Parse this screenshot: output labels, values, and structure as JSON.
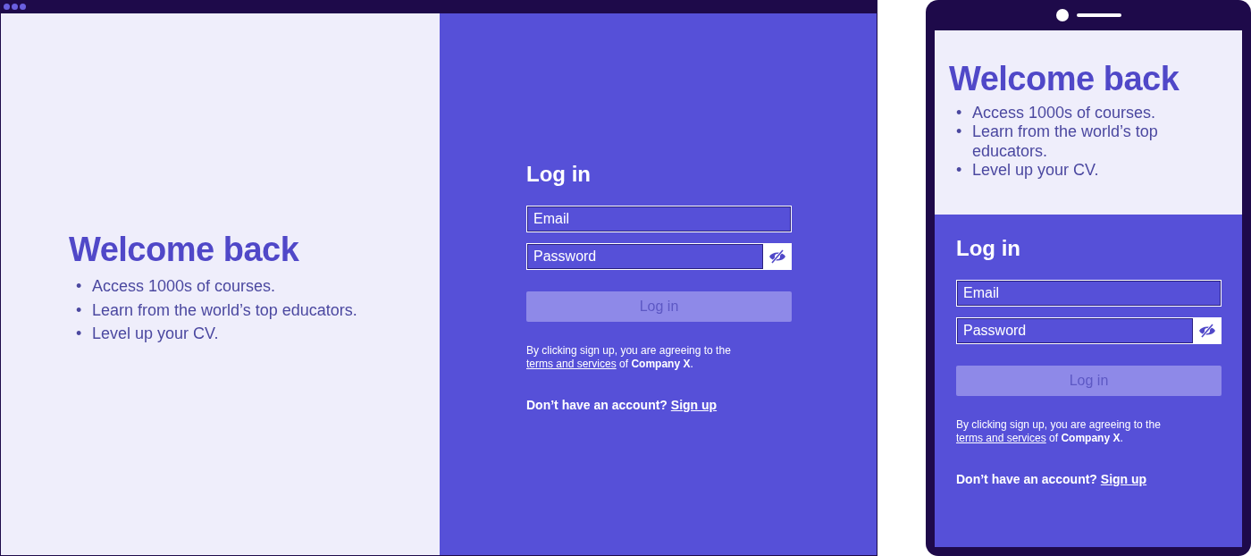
{
  "desktop": {
    "welcome": {
      "title": "Welcome back",
      "points": [
        {
          "bullet": "•",
          "text": "Access 1000s of courses."
        },
        {
          "bullet": "•",
          "text": "Learn from the world’s top educators."
        },
        {
          "bullet": "•",
          "text": "Level up your CV."
        }
      ]
    },
    "login": {
      "title": "Log in",
      "email": {
        "placeholder": "Email"
      },
      "password": {
        "placeholder": "Password"
      },
      "submit": {
        "label": "Log in",
        "disabled": true
      },
      "terms": {
        "before": "By clicking sign up, you are agreeing to the ",
        "link": "terms and services",
        "after": " of **Company X**."
      },
      "signup": {
        "prompt": "Don’t have an account? ",
        "link": "Sign up"
      }
    }
  },
  "mobile": {
    "welcome": {
      "title": "Welcome back",
      "points": [
        {
          "bullet": "•",
          "text": "Access 1000s of courses."
        },
        {
          "bullet": "•",
          "text": "Learn from the world’s top educators."
        },
        {
          "bullet": "•",
          "text": "Level up your CV."
        }
      ]
    },
    "login": {
      "title": "Log in",
      "email": {
        "placeholder": "Email"
      },
      "password": {
        "placeholder": "Password"
      },
      "submit": {
        "label": "Log in",
        "disabled": true
      },
      "terms": {
        "before": "By clicking sign up, you are agreeing to the ",
        "link": "terms and services",
        "after": " of **Company X**."
      },
      "signup": {
        "prompt": "Don’t have an account? ",
        "link": "Sign up"
      }
    }
  }
}
